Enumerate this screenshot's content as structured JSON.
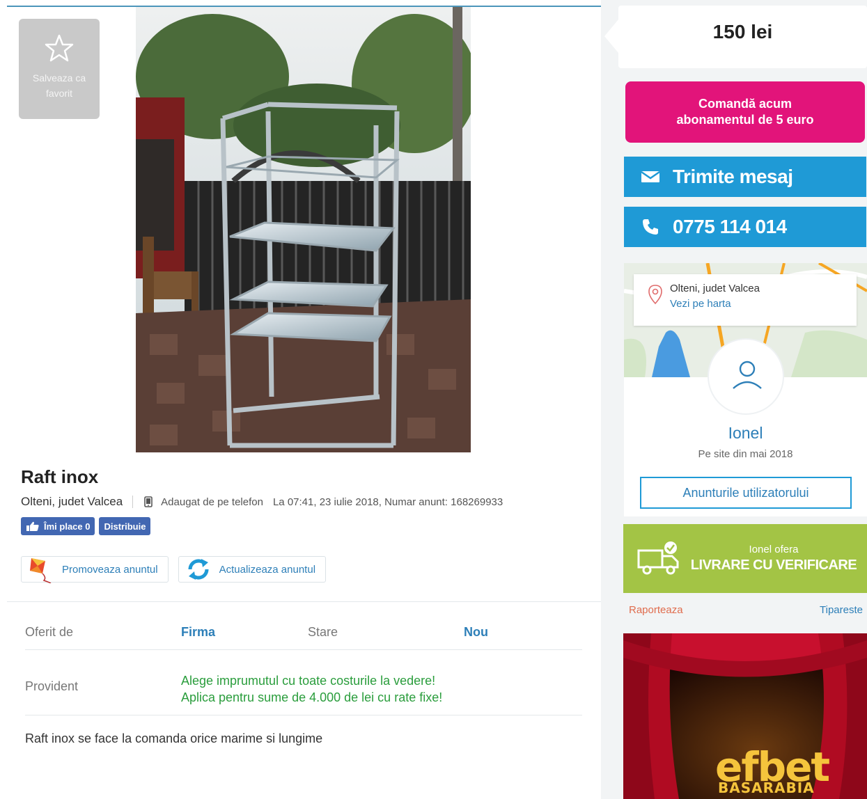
{
  "favorite": {
    "label": "Salveaza ca favorit"
  },
  "listing": {
    "title": "Raft inox",
    "location": "Olteni, judet Valcea",
    "added_from": "Adaugat de pe telefon",
    "posted_info": "La 07:41, 23 iulie 2018, Numar anunt: 168269933"
  },
  "social": {
    "like_label": "Îmi place 0",
    "share_label": "Distribuie"
  },
  "actions": {
    "promote_label": "Promoveaza anuntul",
    "update_label": "Actualizeaza anuntul"
  },
  "details": {
    "offered_by_label": "Oferit de",
    "offered_by_value": "Firma",
    "condition_label": "Stare",
    "condition_value": "Nou",
    "sponsor_label": "Provident",
    "sponsor_line1": "Alege imprumutul cu toate costurile la vedere!",
    "sponsor_line2": "Aplica pentru sume de 4.000 de lei cu rate fixe!"
  },
  "description": "Raft inox se face la comanda orice marime si lungime",
  "sidebar": {
    "price": "150 lei",
    "order_line1": "Comandă acum",
    "order_line2": "abonamentul de 5 euro",
    "message_label": "Trimite mesaj",
    "phone_number": "0775 114 014",
    "map_location": "Olteni, judet Valcea",
    "map_link": "Vezi pe harta",
    "user_name": "Ionel",
    "user_since": "Pe site din mai 2018",
    "user_ads_label": "Anunturile utilizatorului",
    "delivery_line1": "Ionel ofera",
    "delivery_line2": "LIVRARE CU VERIFICARE",
    "report_label": "Raporteaza",
    "print_label": "Tipareste"
  },
  "ad": {
    "logo_text": "efbet",
    "logo_subtext": "BASARABIA"
  },
  "colors": {
    "accent_blue": "#1f9ad6",
    "link_blue": "#2d7fb8",
    "order_pink": "#e2147a",
    "delivery_green": "#a3c445",
    "promo_green": "#2a9d3c",
    "facebook_blue": "#4267b2"
  },
  "icons": [
    "star-icon",
    "phone-device-icon",
    "thumbs-up-icon",
    "kite-icon",
    "refresh-icon",
    "envelope-icon",
    "phone-icon",
    "map-pin-icon",
    "user-icon",
    "truck-icon"
  ]
}
